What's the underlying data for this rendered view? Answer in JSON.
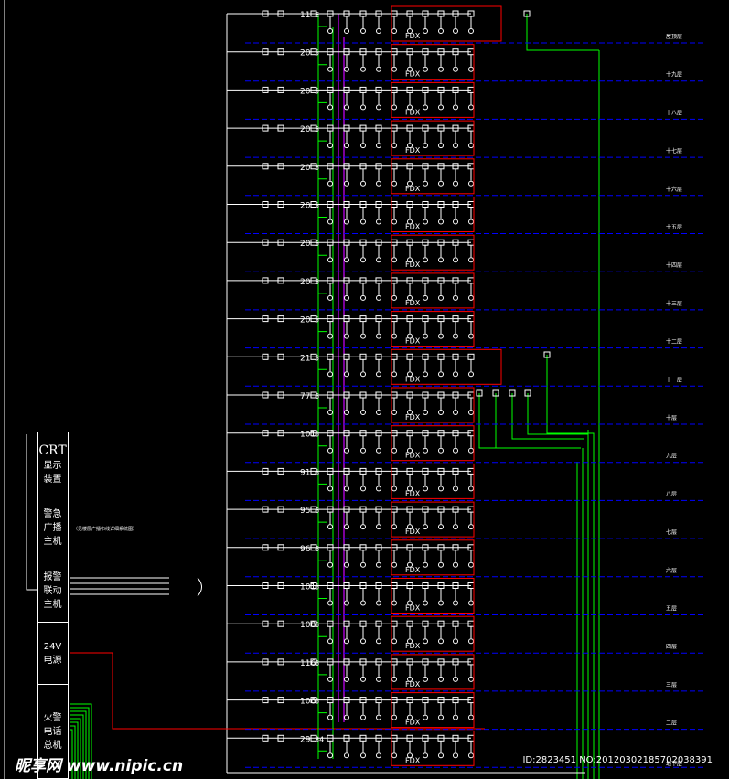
{
  "diagram": {
    "floors": [
      {
        "label": "屋顶层",
        "qty": "11",
        "mod": "E"
      },
      {
        "label": "十九层",
        "qty": "20",
        "mod": "5"
      },
      {
        "label": "十八层",
        "qty": "20",
        "mod": "5"
      },
      {
        "label": "十七层",
        "qty": "20",
        "mod": "5"
      },
      {
        "label": "十六层",
        "qty": "20",
        "mod": "5"
      },
      {
        "label": "十五层",
        "qty": "20",
        "mod": "5"
      },
      {
        "label": "十四层",
        "qty": "20",
        "mod": "5"
      },
      {
        "label": "十三层",
        "qty": "20",
        "mod": "5"
      },
      {
        "label": "十二层",
        "qty": "20",
        "mod": "5"
      },
      {
        "label": "十一层",
        "qty": "21",
        "mod": "5"
      },
      {
        "label": "十层",
        "qty": "77",
        "mod": "6"
      },
      {
        "label": "九层",
        "qty": "101",
        "mod": "6"
      },
      {
        "label": "八层",
        "qty": "91",
        "mod": "6"
      },
      {
        "label": "七层",
        "qty": "95",
        "mod": "6"
      },
      {
        "label": "六层",
        "qty": "96",
        "mod": "6"
      },
      {
        "label": "五层",
        "qty": "101",
        "mod": "6"
      },
      {
        "label": "四层",
        "qty": "108",
        "mod": "6"
      },
      {
        "label": "三层",
        "qty": "116",
        "mod": "6"
      },
      {
        "label": "二层",
        "qty": "106",
        "mod": "6"
      },
      {
        "label": "地下层",
        "qty": "29",
        "mod": "34"
      }
    ],
    "fdx_label": "FDX",
    "equipment": {
      "crt_title": "CRT",
      "crt_sub1": "显示",
      "crt_sub2": "装置",
      "broadcast1": "警急",
      "broadcast2": "广播",
      "broadcast3": "主机",
      "linkage1": "报警",
      "linkage2": "联动",
      "linkage3": "主机",
      "power1": "24V",
      "power2": "电源",
      "phone1": "火警",
      "phone2": "电话",
      "phone3": "总机"
    },
    "note": "（见楼层广播布线详细系统图）"
  },
  "watermark": {
    "left": "昵享网 www.nipic.cn",
    "right": "ID:2823451 NO:20120302185702038391"
  },
  "colors": {
    "background": "#000000",
    "wire": "#ffffff",
    "bus_green": "#00ff00",
    "bus_magenta": "#cc00ff",
    "floor_dash": "#0000ff",
    "zone_box": "#ff0000"
  }
}
